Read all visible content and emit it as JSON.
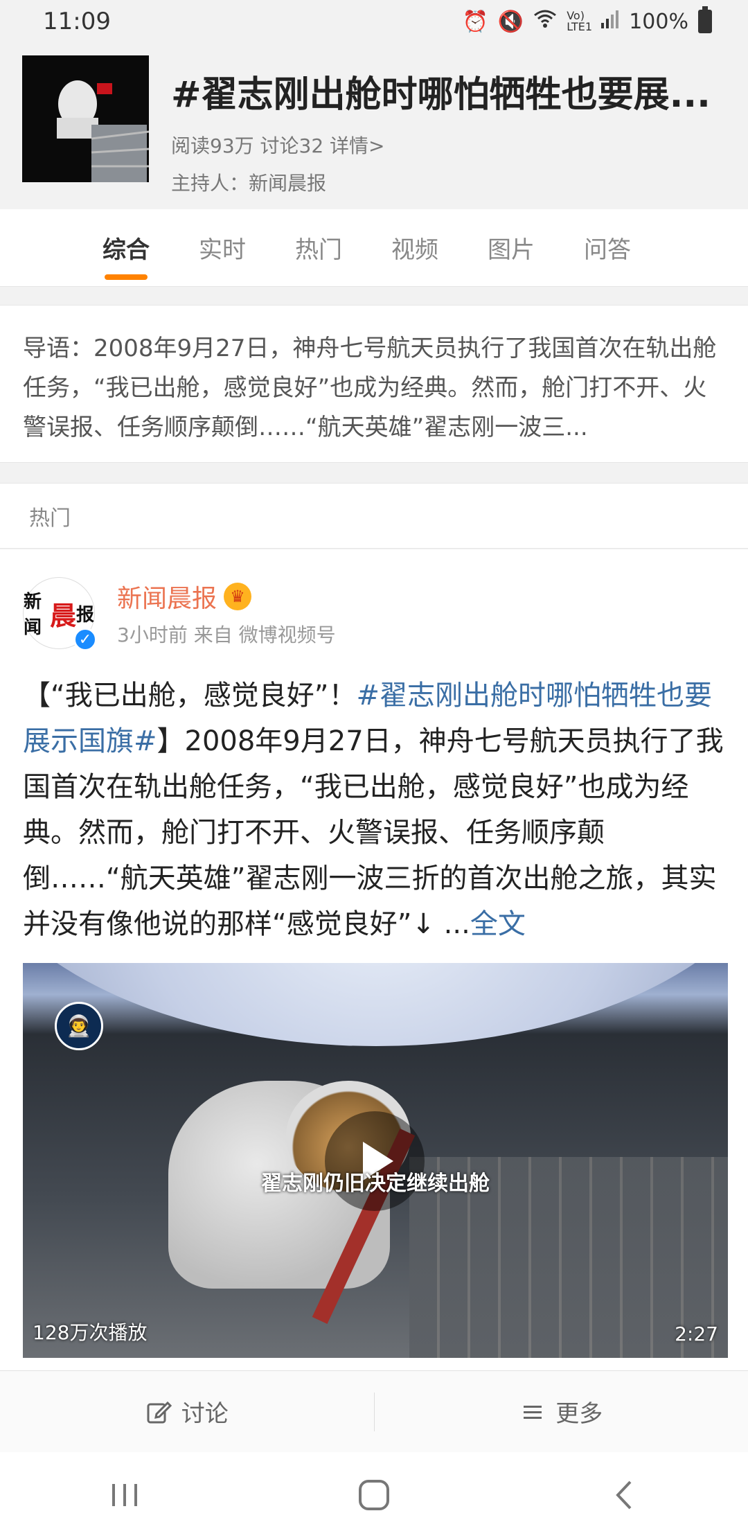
{
  "status": {
    "time": "11:09",
    "signal_text": "Vo) LTE1",
    "battery": "100%"
  },
  "topic": {
    "title": "#翟志刚出舱时哪怕牺牲也要展...",
    "stats": "阅读93万 讨论32 详情>",
    "host": "主持人：新闻晨报"
  },
  "tabs": [
    "综合",
    "实时",
    "热门",
    "视频",
    "图片",
    "问答"
  ],
  "intro": {
    "text": "导语：2008年9月27日，神舟七号航天员执行了我国首次在轨出舱任务，“我已出舱，感觉良好”也成为经典。然而，舱门打不开、火警误报、任务顺序颠倒……“航天英雄”翟志刚一波三..."
  },
  "section_label": "热门",
  "post": {
    "author": "新闻晨报",
    "avatar_text_a": "新闻",
    "avatar_text_b": "晨",
    "avatar_text_c": "报",
    "time_source": "3小时前 来自 微博视频号",
    "body_prefix": "【“我已出舱，感觉良好”！",
    "body_link": "#翟志刚出舱时哪怕牺牲也要展示国旗#",
    "body_main": "】2008年9月27日，神舟七号航天员执行了我国首次在轨出舱任务，“我已出舱，感觉良好”也成为经典。然而，舱门打不开、火警误报、任务顺序颠倒……“航天英雄”翟志刚一波三折的首次出舱之旅，其实并没有像他说的那样“感觉良好”↓ ...",
    "full_text_link": "全文",
    "video": {
      "subtitle": "翟志刚仍旧决定继续出舱",
      "plays": "128万次播放",
      "duration": "2:27"
    }
  },
  "bottom_actions": {
    "discuss": "讨论",
    "more": "更多"
  },
  "colors": {
    "accent": "#ff8200",
    "link": "#3a6ea5",
    "author": "#eb7350"
  }
}
